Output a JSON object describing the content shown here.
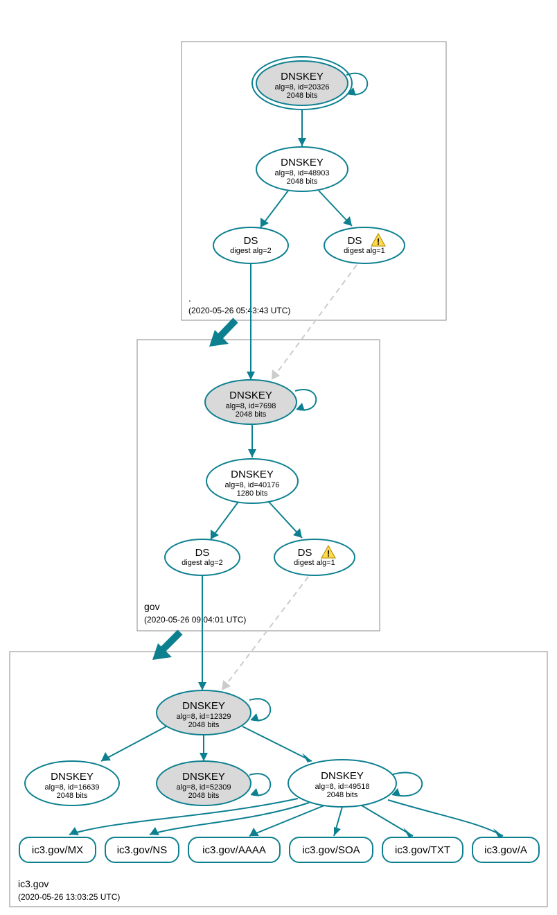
{
  "colors": {
    "stroke": "#0d8090",
    "fill_grey": "#d9d9d9",
    "dash": "#cccccc",
    "warn": "#ffd94a"
  },
  "zones": {
    "root": {
      "label": ".",
      "timestamp": "(2020-05-26 05:43:43 UTC)"
    },
    "gov": {
      "label": "gov",
      "timestamp": "(2020-05-26 09:04:01 UTC)"
    },
    "ic3": {
      "label": "ic3.gov",
      "timestamp": "(2020-05-26 13:03:25 UTC)"
    }
  },
  "nodes": {
    "root_ksk": {
      "title": "DNSKEY",
      "sub1": "alg=8, id=20326",
      "sub2": "2048 bits"
    },
    "root_zsk": {
      "title": "DNSKEY",
      "sub1": "alg=8, id=48903",
      "sub2": "2048 bits"
    },
    "root_ds2": {
      "title": "DS",
      "sub1": "digest alg=2"
    },
    "root_ds1": {
      "title": "DS",
      "sub1": "digest alg=1",
      "warn": true
    },
    "gov_ksk": {
      "title": "DNSKEY",
      "sub1": "alg=8, id=7698",
      "sub2": "2048 bits"
    },
    "gov_zsk": {
      "title": "DNSKEY",
      "sub1": "alg=8, id=40176",
      "sub2": "1280 bits"
    },
    "gov_ds2": {
      "title": "DS",
      "sub1": "digest alg=2"
    },
    "gov_ds1": {
      "title": "DS",
      "sub1": "digest alg=1",
      "warn": true
    },
    "ic3_ksk": {
      "title": "DNSKEY",
      "sub1": "alg=8, id=12329",
      "sub2": "2048 bits"
    },
    "ic3_k1": {
      "title": "DNSKEY",
      "sub1": "alg=8, id=16639",
      "sub2": "2048 bits"
    },
    "ic3_k2": {
      "title": "DNSKEY",
      "sub1": "alg=8, id=52309",
      "sub2": "2048 bits"
    },
    "ic3_k3": {
      "title": "DNSKEY",
      "sub1": "alg=8, id=49518",
      "sub2": "2048 bits"
    }
  },
  "rr": {
    "mx": "ic3.gov/MX",
    "ns": "ic3.gov/NS",
    "aaaa": "ic3.gov/AAAA",
    "soa": "ic3.gov/SOA",
    "txt": "ic3.gov/TXT",
    "a": "ic3.gov/A"
  }
}
